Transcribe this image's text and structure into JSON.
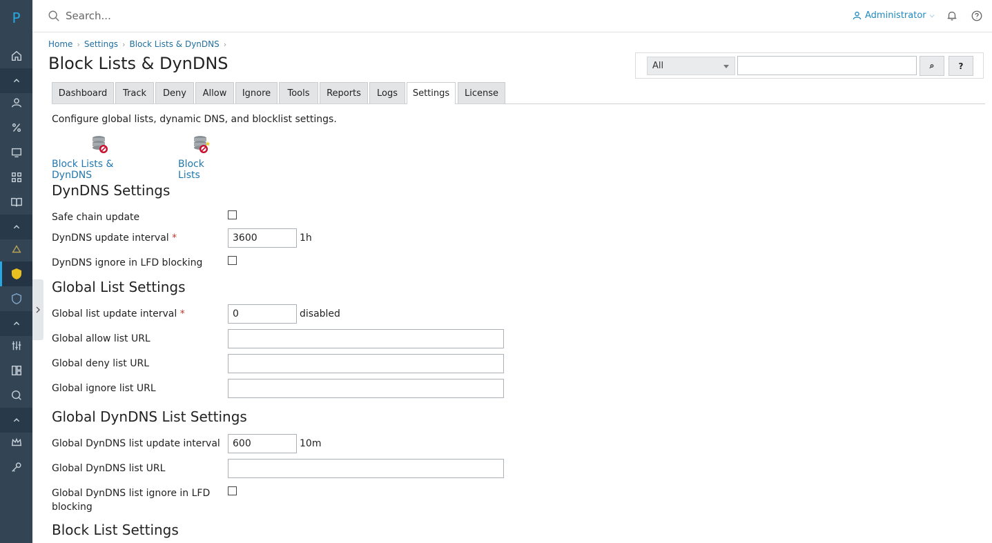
{
  "app": {
    "logo": "P"
  },
  "topbar": {
    "search_placeholder": "Search...",
    "user_name": "Administrator"
  },
  "breadcrumb": [
    "Home",
    "Settings",
    "Block Lists & DynDNS"
  ],
  "page_title": "Block Lists & DynDNS",
  "search_box": {
    "filter_value": "All",
    "search_button": "⌕",
    "help_button": "?"
  },
  "tabs": [
    {
      "label": "Dashboard"
    },
    {
      "label": "Track"
    },
    {
      "label": "Deny"
    },
    {
      "label": "Allow"
    },
    {
      "label": "Ignore"
    },
    {
      "label": "Tools"
    },
    {
      "label": "Reports"
    },
    {
      "label": "Logs"
    },
    {
      "label": "Settings",
      "active": true
    },
    {
      "label": "License"
    }
  ],
  "intro": "Configure global lists, dynamic DNS, and blocklist settings.",
  "tools": [
    {
      "label": "Block Lists & DynDNS",
      "icon": "database-block-icon"
    },
    {
      "label": "Block Lists",
      "icon": "database-block-star-icon"
    }
  ],
  "sections": {
    "dyndns": {
      "title": "DynDNS Settings",
      "safe_chain_label": "Safe chain update",
      "interval_label": "DynDNS update interval",
      "interval_value": "3600",
      "interval_hint": "1h",
      "ignore_label": "DynDNS ignore in LFD blocking"
    },
    "global": {
      "title": "Global List Settings",
      "interval_label": "Global list update interval",
      "interval_value": "0",
      "interval_hint": "disabled",
      "allow_label": "Global allow list URL",
      "deny_label": "Global deny list URL",
      "ignore_label": "Global ignore list URL"
    },
    "global_dyndns": {
      "title": "Global DynDNS List Settings",
      "interval_label": "Global DynDNS list update interval",
      "interval_value": "600",
      "interval_hint": "10m",
      "url_label": "Global DynDNS list URL",
      "ignore_label_1": "Global DynDNS list ignore in LFD",
      "ignore_label_2": "blocking"
    },
    "block_list": {
      "title": "Block List Settings"
    }
  },
  "required_mark": "*",
  "colors": {
    "rail": "#334454",
    "accent": "#28a8e0",
    "link": "#1f78b0",
    "required": "#c0392b"
  }
}
